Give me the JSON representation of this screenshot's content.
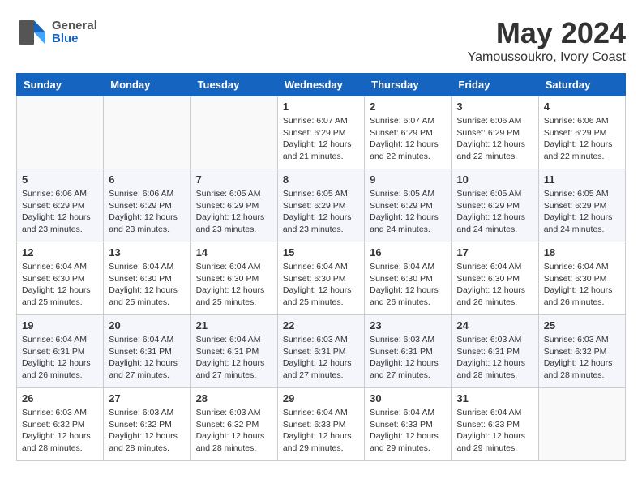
{
  "header": {
    "logo_general": "General",
    "logo_blue": "Blue",
    "month": "May 2024",
    "location": "Yamoussoukro, Ivory Coast"
  },
  "days_of_week": [
    "Sunday",
    "Monday",
    "Tuesday",
    "Wednesday",
    "Thursday",
    "Friday",
    "Saturday"
  ],
  "weeks": [
    [
      {
        "day": "",
        "info": ""
      },
      {
        "day": "",
        "info": ""
      },
      {
        "day": "",
        "info": ""
      },
      {
        "day": "1",
        "info": "Sunrise: 6:07 AM\nSunset: 6:29 PM\nDaylight: 12 hours\nand 21 minutes."
      },
      {
        "day": "2",
        "info": "Sunrise: 6:07 AM\nSunset: 6:29 PM\nDaylight: 12 hours\nand 22 minutes."
      },
      {
        "day": "3",
        "info": "Sunrise: 6:06 AM\nSunset: 6:29 PM\nDaylight: 12 hours\nand 22 minutes."
      },
      {
        "day": "4",
        "info": "Sunrise: 6:06 AM\nSunset: 6:29 PM\nDaylight: 12 hours\nand 22 minutes."
      }
    ],
    [
      {
        "day": "5",
        "info": "Sunrise: 6:06 AM\nSunset: 6:29 PM\nDaylight: 12 hours\nand 23 minutes."
      },
      {
        "day": "6",
        "info": "Sunrise: 6:06 AM\nSunset: 6:29 PM\nDaylight: 12 hours\nand 23 minutes."
      },
      {
        "day": "7",
        "info": "Sunrise: 6:05 AM\nSunset: 6:29 PM\nDaylight: 12 hours\nand 23 minutes."
      },
      {
        "day": "8",
        "info": "Sunrise: 6:05 AM\nSunset: 6:29 PM\nDaylight: 12 hours\nand 23 minutes."
      },
      {
        "day": "9",
        "info": "Sunrise: 6:05 AM\nSunset: 6:29 PM\nDaylight: 12 hours\nand 24 minutes."
      },
      {
        "day": "10",
        "info": "Sunrise: 6:05 AM\nSunset: 6:29 PM\nDaylight: 12 hours\nand 24 minutes."
      },
      {
        "day": "11",
        "info": "Sunrise: 6:05 AM\nSunset: 6:29 PM\nDaylight: 12 hours\nand 24 minutes."
      }
    ],
    [
      {
        "day": "12",
        "info": "Sunrise: 6:04 AM\nSunset: 6:30 PM\nDaylight: 12 hours\nand 25 minutes."
      },
      {
        "day": "13",
        "info": "Sunrise: 6:04 AM\nSunset: 6:30 PM\nDaylight: 12 hours\nand 25 minutes."
      },
      {
        "day": "14",
        "info": "Sunrise: 6:04 AM\nSunset: 6:30 PM\nDaylight: 12 hours\nand 25 minutes."
      },
      {
        "day": "15",
        "info": "Sunrise: 6:04 AM\nSunset: 6:30 PM\nDaylight: 12 hours\nand 25 minutes."
      },
      {
        "day": "16",
        "info": "Sunrise: 6:04 AM\nSunset: 6:30 PM\nDaylight: 12 hours\nand 26 minutes."
      },
      {
        "day": "17",
        "info": "Sunrise: 6:04 AM\nSunset: 6:30 PM\nDaylight: 12 hours\nand 26 minutes."
      },
      {
        "day": "18",
        "info": "Sunrise: 6:04 AM\nSunset: 6:30 PM\nDaylight: 12 hours\nand 26 minutes."
      }
    ],
    [
      {
        "day": "19",
        "info": "Sunrise: 6:04 AM\nSunset: 6:31 PM\nDaylight: 12 hours\nand 26 minutes."
      },
      {
        "day": "20",
        "info": "Sunrise: 6:04 AM\nSunset: 6:31 PM\nDaylight: 12 hours\nand 27 minutes."
      },
      {
        "day": "21",
        "info": "Sunrise: 6:04 AM\nSunset: 6:31 PM\nDaylight: 12 hours\nand 27 minutes."
      },
      {
        "day": "22",
        "info": "Sunrise: 6:03 AM\nSunset: 6:31 PM\nDaylight: 12 hours\nand 27 minutes."
      },
      {
        "day": "23",
        "info": "Sunrise: 6:03 AM\nSunset: 6:31 PM\nDaylight: 12 hours\nand 27 minutes."
      },
      {
        "day": "24",
        "info": "Sunrise: 6:03 AM\nSunset: 6:31 PM\nDaylight: 12 hours\nand 28 minutes."
      },
      {
        "day": "25",
        "info": "Sunrise: 6:03 AM\nSunset: 6:32 PM\nDaylight: 12 hours\nand 28 minutes."
      }
    ],
    [
      {
        "day": "26",
        "info": "Sunrise: 6:03 AM\nSunset: 6:32 PM\nDaylight: 12 hours\nand 28 minutes."
      },
      {
        "day": "27",
        "info": "Sunrise: 6:03 AM\nSunset: 6:32 PM\nDaylight: 12 hours\nand 28 minutes."
      },
      {
        "day": "28",
        "info": "Sunrise: 6:03 AM\nSunset: 6:32 PM\nDaylight: 12 hours\nand 28 minutes."
      },
      {
        "day": "29",
        "info": "Sunrise: 6:04 AM\nSunset: 6:33 PM\nDaylight: 12 hours\nand 29 minutes."
      },
      {
        "day": "30",
        "info": "Sunrise: 6:04 AM\nSunset: 6:33 PM\nDaylight: 12 hours\nand 29 minutes."
      },
      {
        "day": "31",
        "info": "Sunrise: 6:04 AM\nSunset: 6:33 PM\nDaylight: 12 hours\nand 29 minutes."
      },
      {
        "day": "",
        "info": ""
      }
    ]
  ]
}
